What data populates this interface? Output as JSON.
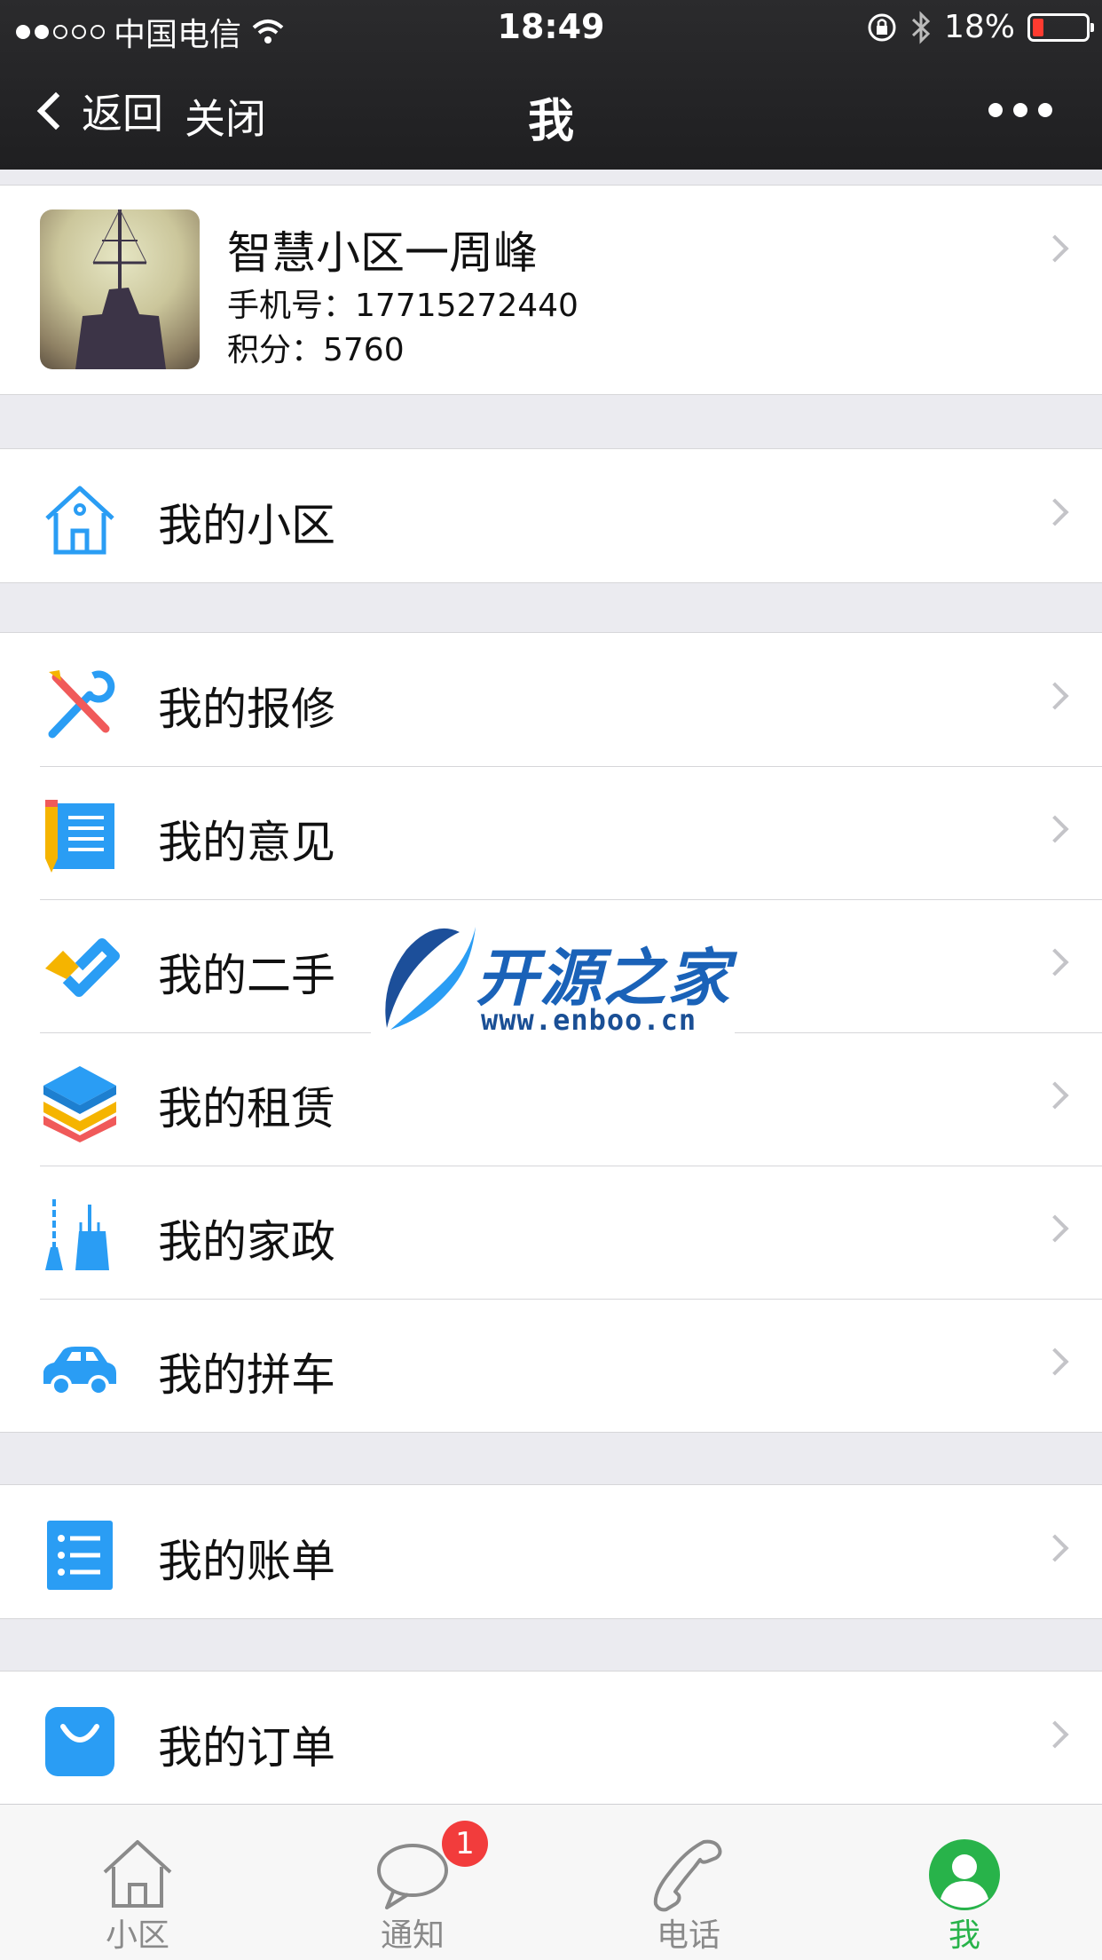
{
  "status_bar": {
    "carrier": "中国电信",
    "time": "18:49",
    "battery": "18%",
    "battery_level": 0.18,
    "signal_strength": 2
  },
  "nav": {
    "back_label": "返回",
    "close_label": "关闭",
    "title": "我"
  },
  "profile": {
    "name": "智慧小区一周峰",
    "phone": "手机号：17715272440",
    "points": "积分：5760"
  },
  "menu_groups": [
    {
      "items": [
        {
          "label": "我的小区",
          "icon": "house-icon"
        }
      ]
    },
    {
      "items": [
        {
          "label": "我的报修",
          "icon": "repair-tools-icon"
        },
        {
          "label": "我的意见",
          "icon": "feedback-notepad-icon"
        },
        {
          "label": "我的二手",
          "icon": "secondhand-tag-icon"
        },
        {
          "label": "我的租赁",
          "icon": "rental-layers-icon"
        },
        {
          "label": "我的家政",
          "icon": "housekeeping-broom-icon"
        },
        {
          "label": "我的拼车",
          "icon": "carpool-car-icon"
        }
      ]
    },
    {
      "items": [
        {
          "label": "我的账单",
          "icon": "bill-list-icon"
        }
      ]
    },
    {
      "items": [
        {
          "label": "我的订单",
          "icon": "order-bag-icon"
        }
      ]
    }
  ],
  "watermark": {
    "brand": "开源之家",
    "url": "www.enboo.cn"
  },
  "tabbar": {
    "tabs": [
      {
        "label": "小区",
        "icon": "home-outline-icon",
        "active": false
      },
      {
        "label": "通知",
        "icon": "chat-bubble-icon",
        "active": false,
        "badge": "1"
      },
      {
        "label": "电话",
        "icon": "phone-icon",
        "active": false
      },
      {
        "label": "我",
        "icon": "person-icon",
        "active": true
      }
    ]
  },
  "colors": {
    "accent_blue": "#2a9df4",
    "active_green": "#28b34a",
    "badge_red": "#f23c3c"
  }
}
